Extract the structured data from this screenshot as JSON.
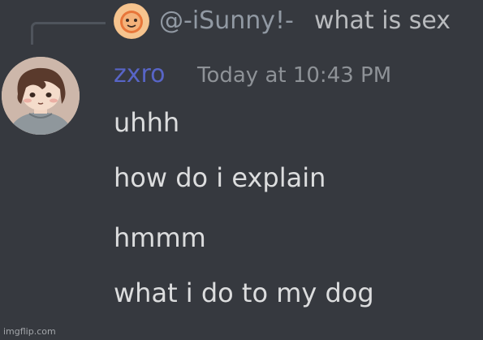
{
  "reply": {
    "avatar_icon": "sun-avatar-icon",
    "username": "@-iSunny!-",
    "message": "what is sex"
  },
  "message": {
    "avatar_icon": "user-avatar",
    "username": "zxro",
    "timestamp": "Today at 10:43 PM",
    "lines": [
      "uhhh",
      "how do i explain",
      "hmmm",
      "what i do to my dog"
    ]
  },
  "watermark": "imgflip.com",
  "colors": {
    "background": "#36393f",
    "username": "#5865c7",
    "reply_username": "#9199a3",
    "text": "#dcddde",
    "timestamp": "#8e9297"
  }
}
